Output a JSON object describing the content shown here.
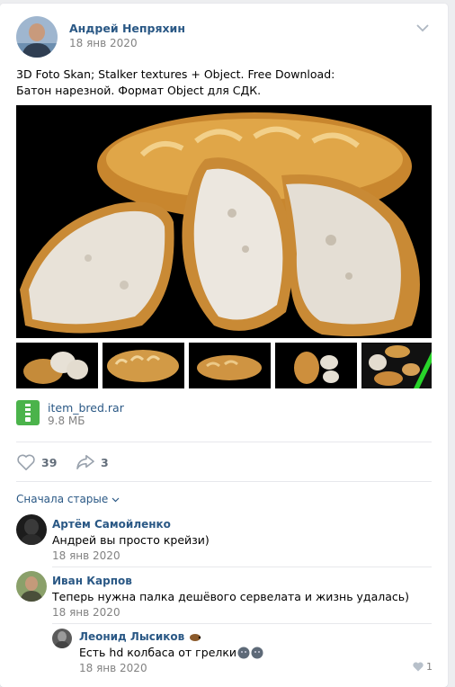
{
  "post": {
    "author": "Андрей Непряхин",
    "date": "18 янв 2020",
    "text_line1": "3D Foto Skan; Stalker textures + Object. Free Download:",
    "text_line2": "Батон нарезной. Формат Object для СДК.",
    "attachment": {
      "name": "item_bred.rar",
      "size": "9.8 МБ"
    },
    "likes": "39",
    "shares": "3"
  },
  "comments": {
    "sort_label": "Сначала старые",
    "items": [
      {
        "name": "Артём Самойленко",
        "text": "Андрей вы просто крейзи)",
        "date": "18 янв 2020"
      },
      {
        "name": "Иван Карпов",
        "text": "Теперь нужна палка дешёвого сервелата и жизнь удалась)",
        "date": "18 янв 2020"
      }
    ],
    "reply": {
      "name": "Леонид Лысиков",
      "text": "Есть hd колбаса от грелки",
      "date": "18 янв 2020",
      "likes": "1"
    }
  },
  "colors": {
    "link": "#2a5885",
    "muted": "#828282",
    "file_icon": "#4bb34b"
  }
}
